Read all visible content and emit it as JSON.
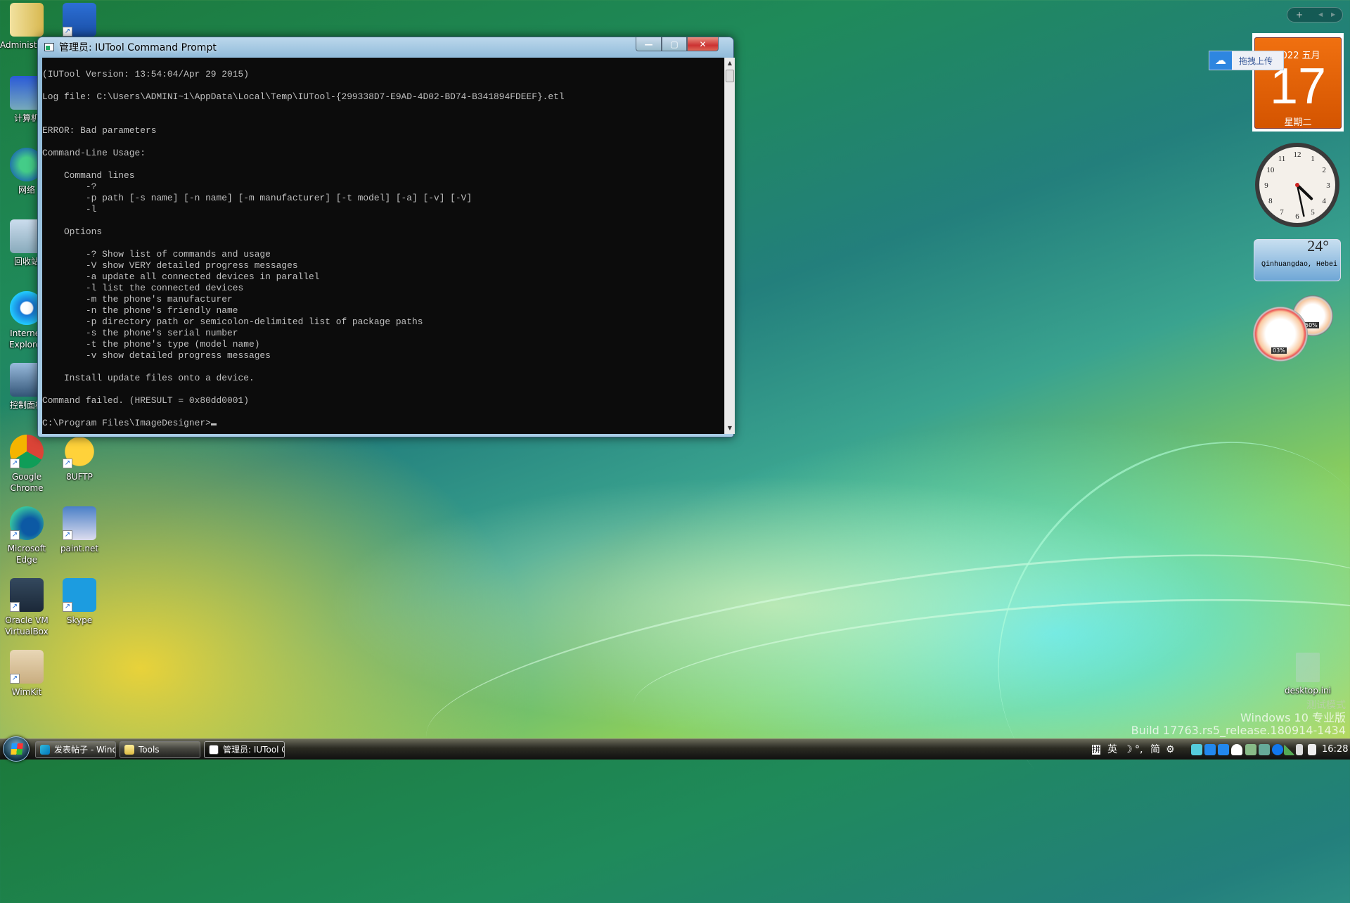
{
  "desktop_icons": [
    {
      "label": "Administrator",
      "icon": "user-folder-icon"
    },
    {
      "label": "计算机",
      "icon": "computer-icon"
    },
    {
      "label": "网络",
      "icon": "network-icon"
    },
    {
      "label": "回收站",
      "icon": "recycle-bin-icon"
    },
    {
      "label": "Internet Explorer",
      "icon": "internet-explorer-icon"
    },
    {
      "label": "控制面板",
      "icon": "control-panel-icon"
    },
    {
      "label": "Google Chrome",
      "icon": "chrome-icon"
    },
    {
      "label": "Microsoft Edge",
      "icon": "edge-icon"
    },
    {
      "label": "Oracle VM VirtualBox",
      "icon": "virtualbox-icon"
    },
    {
      "label": "WimKit",
      "icon": "wimkit-icon"
    }
  ],
  "desktop_icons_col2": [
    {
      "label": "",
      "icon": "search-document-icon"
    },
    {
      "label": "8UFTP",
      "icon": "8uftp-icon"
    },
    {
      "label": "paint.net",
      "icon": "paintnet-icon"
    },
    {
      "label": "Skype",
      "icon": "skype-icon"
    }
  ],
  "window": {
    "title": "管理员: IUTool Command Prompt",
    "minimize": "—",
    "maximize": "▢",
    "close": "✕",
    "console_lines": [
      "",
      "(IUTool Version: 13:54:04/Apr 29 2015)",
      "",
      "Log file: C:\\Users\\ADMINI~1\\AppData\\Local\\Temp\\IUTool-{299338D7-E9AD-4D02-BD74-B341894FDEEF}.etl",
      "",
      "",
      "ERROR: Bad parameters",
      "",
      "Command-Line Usage:",
      "",
      "    Command lines",
      "        -?",
      "        -p path [-s name] [-n name] [-m manufacturer] [-t model] [-a] [-v] [-V]",
      "        -l",
      "",
      "    Options",
      "",
      "        -? Show list of commands and usage",
      "        -V show VERY detailed progress messages",
      "        -a update all connected devices in parallel",
      "        -l list the connected devices",
      "        -m the phone's manufacturer",
      "        -n the phone's friendly name",
      "        -p directory path or semicolon-delimited list of package paths",
      "        -s the phone's serial number",
      "        -t the phone's type (model name)",
      "        -v show detailed progress messages",
      "",
      "    Install update files onto a device.",
      "",
      "Command failed. (HRESULT = 0x80dd0001)",
      ""
    ],
    "prompt": "C:\\Program Files\\ImageDesigner>"
  },
  "taskbar": {
    "buttons": [
      {
        "label": "发表帖子 - Window...",
        "icon": "edge-icon"
      },
      {
        "label": "Tools",
        "icon": "folder-icon"
      },
      {
        "label": "管理员: IUTool Co...",
        "icon": "console-icon",
        "active": true
      }
    ],
    "ime": {
      "pin": "拼",
      "lang": "英",
      "moon": "☽",
      "punct": "°,",
      "simp": "简",
      "settings": "⚙"
    },
    "clock": "16:28"
  },
  "gadgets": {
    "upload_tooltip": "拖拽上传",
    "calendar": {
      "year_month": "2022 五月",
      "day": "17",
      "weekday": "星期二",
      "color": "#e8600c"
    },
    "clock_time": {
      "hour": 16,
      "minute": 28
    },
    "weather": {
      "temp": "24°",
      "city": "Qinhuangdao, Hebei"
    },
    "meter": {
      "cpu": "03%",
      "memory": "50%"
    }
  },
  "desktop_file": "desktop.ini",
  "watermark": {
    "mode": "测试模式",
    "edition": "Windows 10 专业版",
    "build": "Build 17763.rs5_release.180914-1434"
  }
}
